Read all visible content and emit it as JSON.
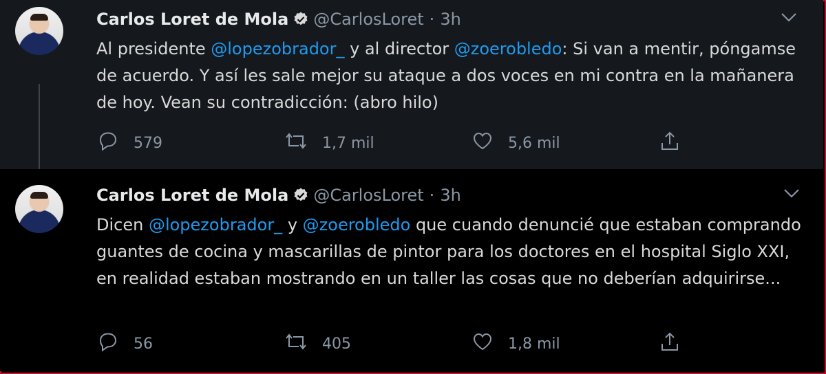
{
  "tweets": [
    {
      "author": "Carlos Loret de Mola",
      "handle": "@CarlosLoret",
      "separator": "·",
      "time": "3h",
      "text_parts": [
        {
          "t": "Al presidente ",
          "m": false
        },
        {
          "t": "@lopezobrador_",
          "m": true
        },
        {
          "t": " y al director ",
          "m": false
        },
        {
          "t": "@zoerobledo",
          "m": true
        },
        {
          "t": ": Si van a mentir, póngamse de acuerdo. Y así les sale mejor su ataque a dos voces en mi contra en la mañanera de hoy. Vean su contradicción: (abro hilo)",
          "m": false
        }
      ],
      "replies": "579",
      "retweets": "1,7 mil",
      "likes": "5,6 mil"
    },
    {
      "author": "Carlos Loret de Mola",
      "handle": "@CarlosLoret",
      "separator": "·",
      "time": "3h",
      "text_parts": [
        {
          "t": "Dicen ",
          "m": false
        },
        {
          "t": "@lopezobrador_",
          "m": true
        },
        {
          "t": " y ",
          "m": false
        },
        {
          "t": "@zoerobledo",
          "m": true
        },
        {
          "t": " que cuando denuncié que estaban comprando guantes de cocina y mascarillas de pintor para los doctores en el hospital Siglo XXI, en realidad estaban mostrando en un taller las cosas que no deberían adquirirse...",
          "m": false
        }
      ],
      "replies": "56",
      "retweets": "405",
      "likes": "1,8 mil"
    }
  ],
  "colors": {
    "mention": "#1d9bf0",
    "muted": "#8b98a5",
    "text": "#d9d9d9",
    "frame": "#c8102e"
  },
  "icons": [
    "verified-badge-icon",
    "chevron-down-icon",
    "reply-icon",
    "retweet-icon",
    "like-icon",
    "share-icon"
  ]
}
